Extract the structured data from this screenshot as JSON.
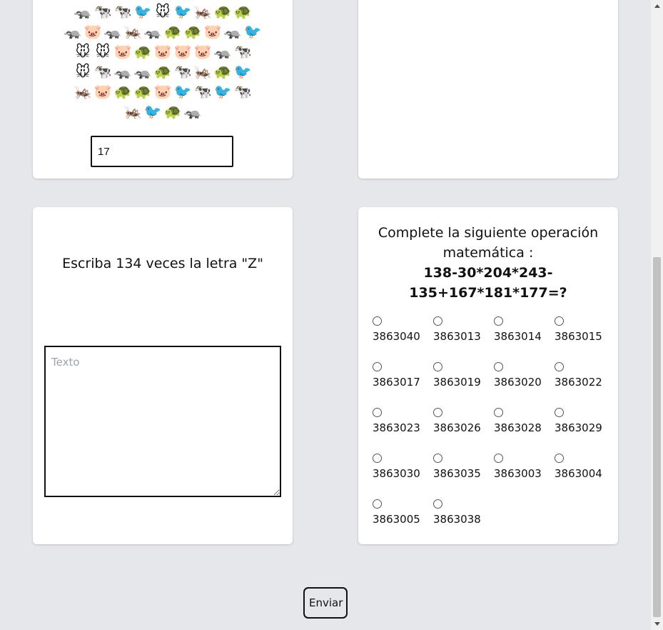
{
  "animals_card": {
    "emoji_rows": [
      [
        "🦡",
        "🐄",
        "🐄",
        "🐦",
        "🐭",
        "🐦",
        "🦗",
        "🐢",
        "🐢"
      ],
      [
        "🦡",
        "🐷",
        "🦡",
        "🦗",
        "🦡",
        "🐢",
        "🐢",
        "🐷",
        "🦡",
        "🐦"
      ],
      [
        "🐭",
        "🐭",
        "🐷",
        "🐢",
        "🐷",
        "🐷",
        "🐷",
        "🦡",
        "🐄"
      ],
      [
        "🐭",
        "🐄",
        "🦡",
        "🦡",
        "🐢",
        "🐄",
        "🦗",
        "🐢",
        "🐦"
      ],
      [
        "🦗",
        "🐷",
        "🐢",
        "🐢",
        "🐷",
        "🐦",
        "🐄",
        "🐦",
        "🐄"
      ],
      [
        "🦗",
        "🐦",
        "🐢",
        "🦡"
      ]
    ],
    "answer_value": "17"
  },
  "letter_card": {
    "prompt": "Escriba 134 veces la letra \"Z\"",
    "textarea_placeholder": "Texto"
  },
  "math_card": {
    "prompt": "Complete la siguiente operación matemática :",
    "operation": "138-30*204*243-135+167*181*177=?",
    "options": [
      "3863040",
      "3863013",
      "3863014",
      "3863015",
      "3863017",
      "3863019",
      "3863020",
      "3863022",
      "3863023",
      "3863026",
      "3863028",
      "3863029",
      "3863030",
      "3863035",
      "3863003",
      "3863004",
      "3863005",
      "3863038"
    ]
  },
  "submit": {
    "label": "Enviar"
  }
}
